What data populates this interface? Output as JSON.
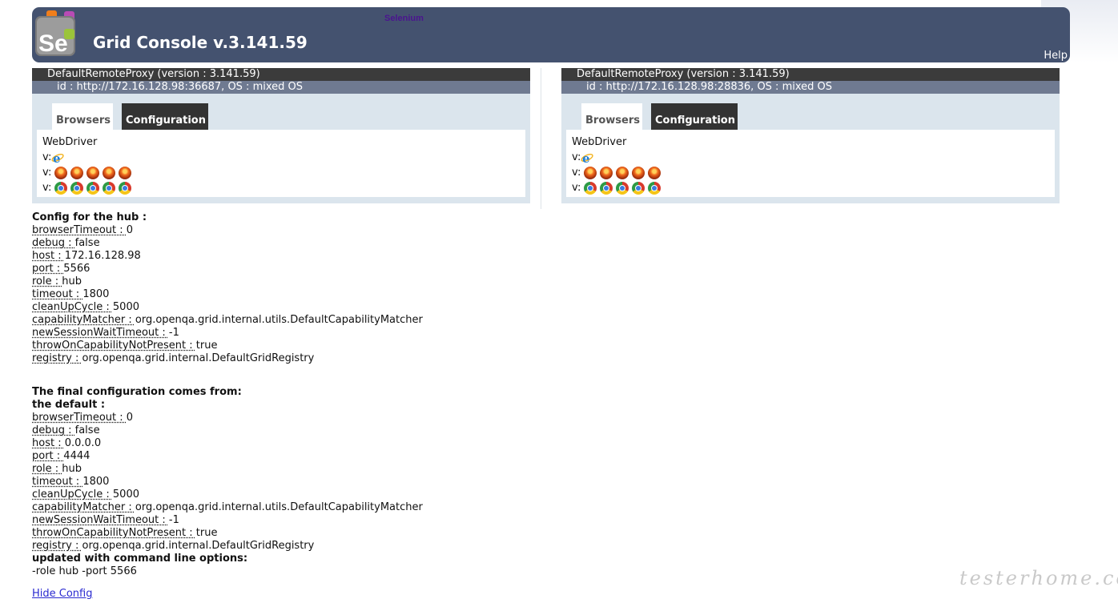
{
  "header": {
    "logo_text": "Selenium",
    "title": "Grid Console v.3.141.59",
    "help": "Help"
  },
  "proxies": [
    {
      "name": "DefaultRemoteProxy (version : 3.141.59)",
      "id": "id : http://172.16.128.98:36687, OS : mixed OS",
      "tabs": [
        "Browsers",
        "Configuration"
      ],
      "protocol": "WebDriver",
      "version_prefix": "v:",
      "rows": [
        {
          "browser_icon": "internet-explorer-icon",
          "count": 1
        },
        {
          "browser_icon": "firefox-icon",
          "count": 5
        },
        {
          "browser_icon": "chrome-icon",
          "count": 5
        }
      ]
    },
    {
      "name": "DefaultRemoteProxy (version : 3.141.59)",
      "id": "id : http://172.16.128.98:28836, OS : mixed OS",
      "tabs": [
        "Browsers",
        "Configuration"
      ],
      "protocol": "WebDriver",
      "version_prefix": "v:",
      "rows": [
        {
          "browser_icon": "internet-explorer-icon",
          "count": 1
        },
        {
          "browser_icon": "firefox-icon",
          "count": 5
        },
        {
          "browser_icon": "chrome-icon",
          "count": 5
        }
      ]
    }
  ],
  "hub_config": {
    "heading": "Config for the hub :",
    "entries": [
      {
        "key": "browserTimeout : ",
        "value": "0"
      },
      {
        "key": "debug : ",
        "value": "false"
      },
      {
        "key": "host : ",
        "value": "172.16.128.98"
      },
      {
        "key": "port : ",
        "value": "5566"
      },
      {
        "key": "role : ",
        "value": "hub"
      },
      {
        "key": "timeout : ",
        "value": "1800"
      },
      {
        "key": "cleanUpCycle : ",
        "value": "5000"
      },
      {
        "key": "capabilityMatcher : ",
        "value": "org.openqa.grid.internal.utils.DefaultCapabilityMatcher"
      },
      {
        "key": "newSessionWaitTimeout : ",
        "value": "-1"
      },
      {
        "key": "throwOnCapabilityNotPresent : ",
        "value": "true"
      },
      {
        "key": "registry : ",
        "value": "org.openqa.grid.internal.DefaultGridRegistry"
      }
    ]
  },
  "final_config": {
    "heading": "The final configuration comes from:",
    "default_heading": "the default :",
    "entries": [
      {
        "key": "browserTimeout : ",
        "value": "0"
      },
      {
        "key": "debug : ",
        "value": "false"
      },
      {
        "key": "host : ",
        "value": "0.0.0.0"
      },
      {
        "key": "port : ",
        "value": "4444"
      },
      {
        "key": "role : ",
        "value": "hub"
      },
      {
        "key": "timeout : ",
        "value": "1800"
      },
      {
        "key": "cleanUpCycle : ",
        "value": "5000"
      },
      {
        "key": "capabilityMatcher : ",
        "value": "org.openqa.grid.internal.utils.DefaultCapabilityMatcher"
      },
      {
        "key": "newSessionWaitTimeout : ",
        "value": "-1"
      },
      {
        "key": "throwOnCapabilityNotPresent : ",
        "value": "true"
      },
      {
        "key": "registry : ",
        "value": "org.openqa.grid.internal.DefaultGridRegistry"
      }
    ],
    "cmdline_heading": "updated with command line options:",
    "cmdline": "-role hub -port 5566"
  },
  "hide_config": "Hide Config",
  "watermark": "testerhome.com",
  "colors": {
    "header_bg": "#44526f",
    "proxy_name_bg": "#3b3b3b",
    "proxy_id_bg": "#6f7a91",
    "proxy_body_bg": "#dbe5ed",
    "link": "#2a2ad0"
  }
}
